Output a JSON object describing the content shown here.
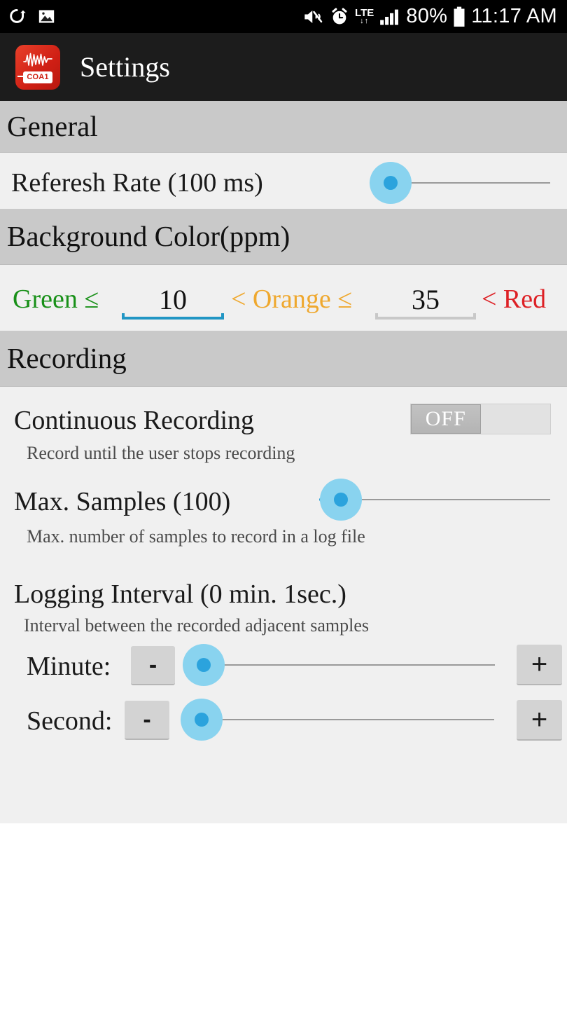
{
  "statusbar": {
    "left_icons": [
      "usb-update-icon",
      "screenshot-image-icon"
    ],
    "right_icons": [
      "mute-vibrate-icon",
      "alarm-clock-icon",
      "lte-data-icon",
      "signal-bars-icon",
      "battery-icon"
    ],
    "lte_label": "LTE",
    "lte_arrows": "↓↑",
    "battery_percent": "80%",
    "clock": "11:17 AM"
  },
  "actionbar": {
    "app_icon_badge": "COA1",
    "title": "Settings"
  },
  "sections": {
    "general": {
      "header": "General",
      "refresh_rate": {
        "label": "Referesh Rate (100 ms)",
        "value": "100 ms"
      }
    },
    "background_color": {
      "header": "Background Color(ppm)",
      "green_label": "Green ≤",
      "green_value": "10",
      "orange_label": "< Orange ≤",
      "orange_value": "35",
      "red_label": "< Red",
      "colors": {
        "green": "#189018",
        "orange": "#efa82e",
        "red": "#dd2025",
        "focused_underline": "#2196c4",
        "unfocused_underline": "#c8c8c8"
      }
    },
    "recording": {
      "header": "Recording",
      "continuous": {
        "label": "Continuous Recording",
        "sub": "Record until the user stops recording",
        "toggle_state": "OFF"
      },
      "max_samples": {
        "label": "Max. Samples (100)",
        "sub": "Max. number of samples to record in a log file",
        "value": "100"
      },
      "logging_interval": {
        "label": "Logging Interval (0 min. 1sec.)",
        "sub": "Interval between the recorded adjacent samples",
        "minute": {
          "label": "Minute:",
          "minus": "-",
          "plus": "+",
          "value": "0"
        },
        "second": {
          "label": "Second:",
          "minus": "-",
          "plus": "+",
          "value": "1"
        }
      }
    }
  }
}
